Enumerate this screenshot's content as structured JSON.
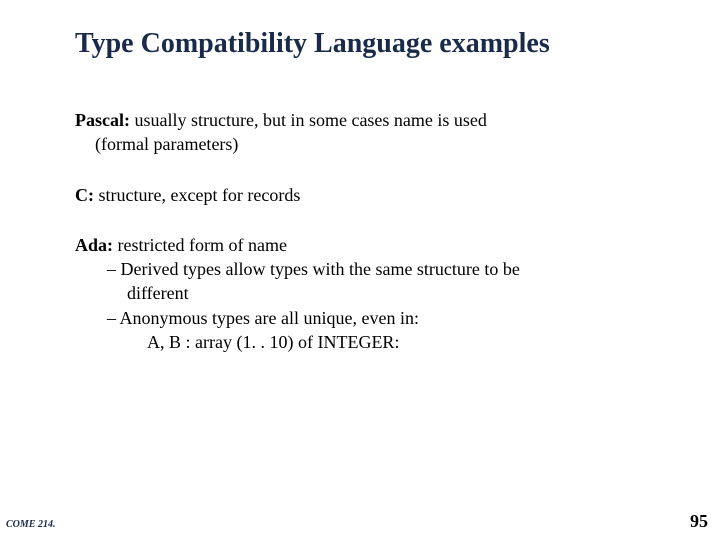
{
  "title": "Type Compatibility Language examples",
  "pascal": {
    "label": "Pascal:",
    "line1": " usually structure, but in some cases name is used",
    "line2": "(formal parameters)"
  },
  "c": {
    "label": "C:",
    "text": " structure, except for records"
  },
  "ada": {
    "label": "Ada:",
    "text": " restricted form of name",
    "bullet1_a": "– Derived types allow types with the same structure to be",
    "bullet1_b": "different",
    "bullet2": "– Anonymous types are all unique, even in:",
    "code": "A, B : array (1. . 10) of INTEGER:"
  },
  "footer_left": "COME 214.",
  "page_number": "95"
}
